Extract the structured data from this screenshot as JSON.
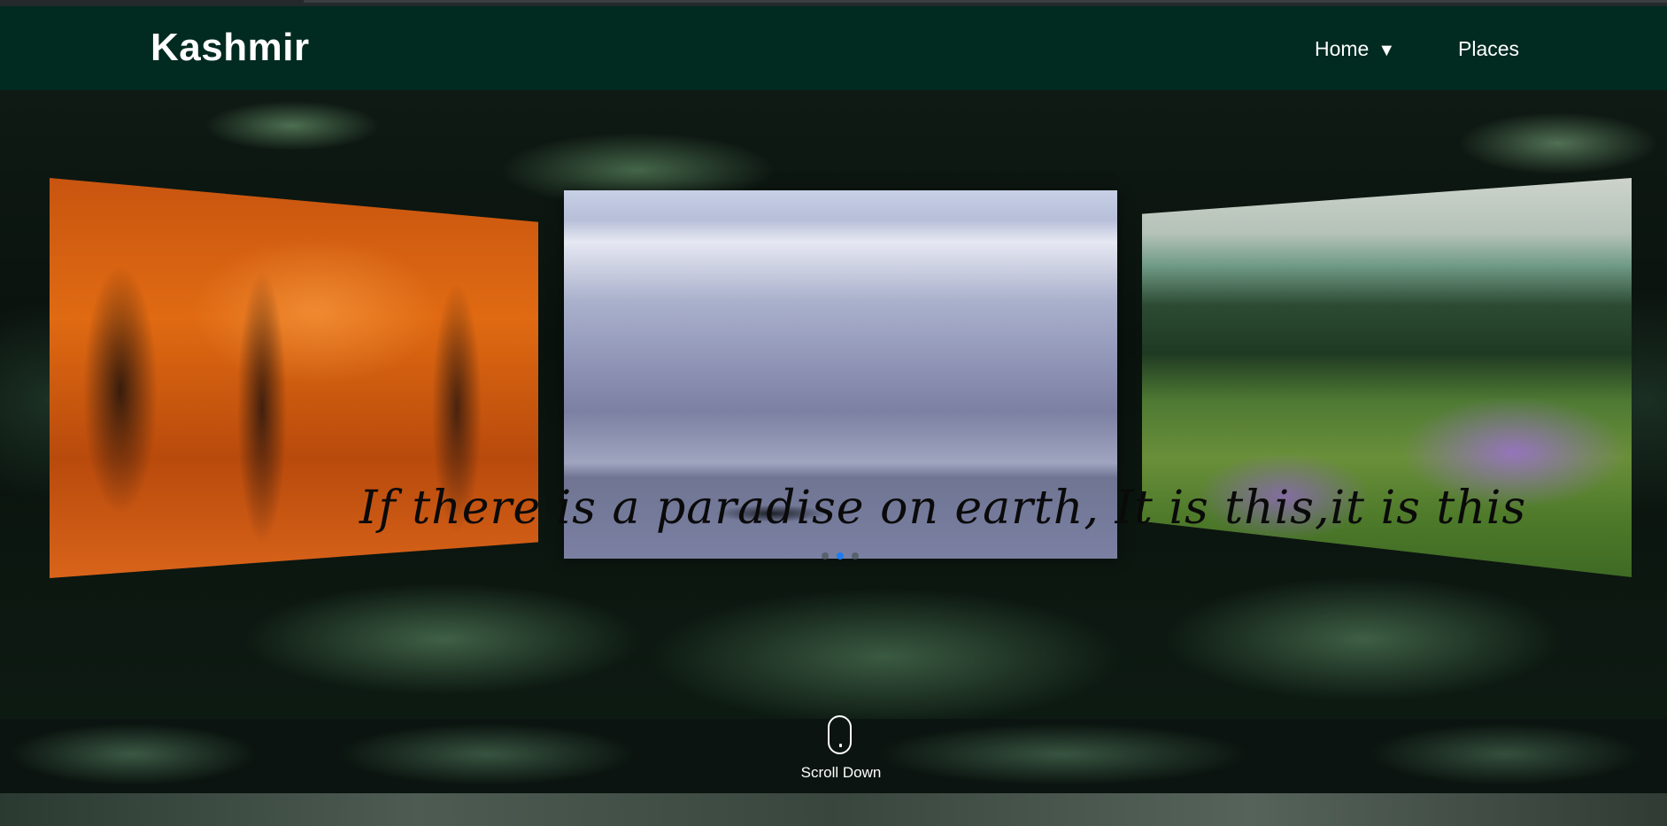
{
  "nav": {
    "brand": "Kashmir",
    "items": [
      {
        "label": "Home",
        "caret": "▼"
      },
      {
        "label": "Places"
      }
    ]
  },
  "hero": {
    "quote": "If there is a paradise on earth, It is this,it is this",
    "slides_count": 3,
    "active_slide": 1
  },
  "scroll": {
    "label": "Scroll Down"
  },
  "colors": {
    "navbar": "#012a20",
    "active_dot": "#1e7cf2"
  },
  "icons": {
    "home_caret": "chevron-down-icon",
    "scroll": "mouse-icon"
  }
}
